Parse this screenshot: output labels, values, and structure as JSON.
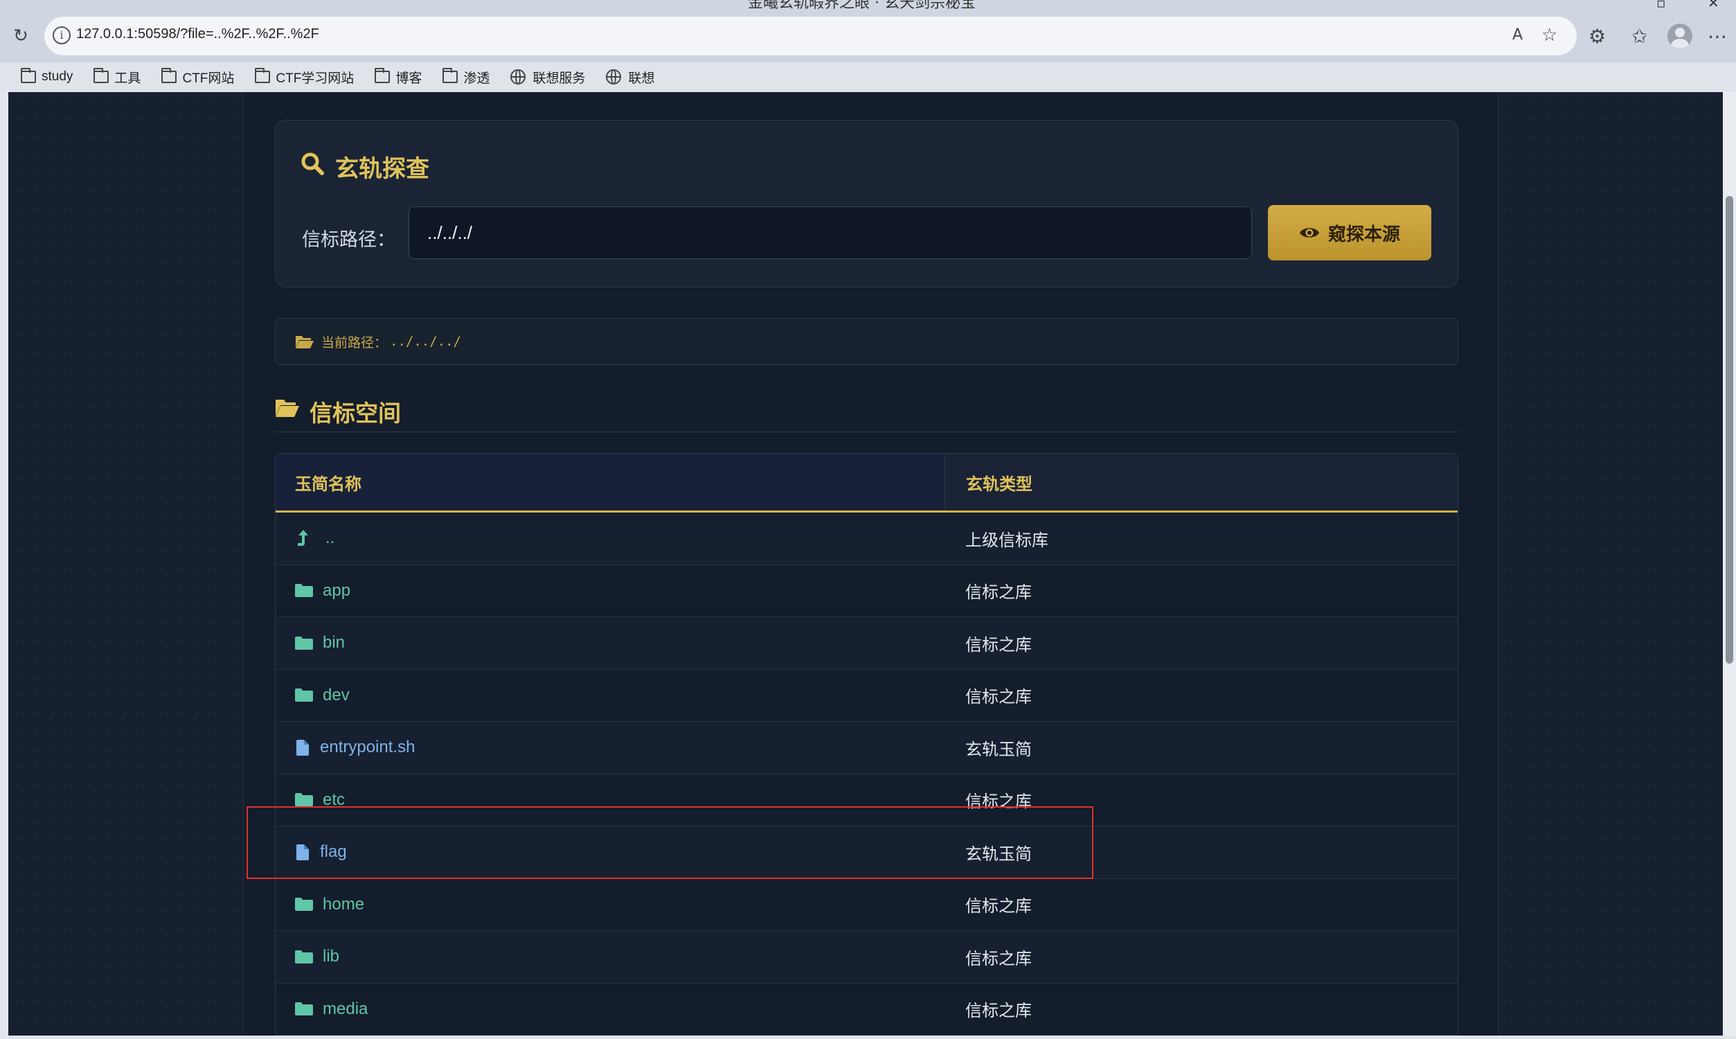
{
  "browser": {
    "window_title": "金曦玄轨暇界之眼 · 玄天剑宗秘宝",
    "url": "127.0.0.1:50598/?file=..%2F..%2F..%2F",
    "bookmarks": [
      {
        "label": "study",
        "icon": "folder-icon"
      },
      {
        "label": "工具",
        "icon": "folder-icon"
      },
      {
        "label": "CTF网站",
        "icon": "folder-icon"
      },
      {
        "label": "CTF学习网站",
        "icon": "folder-icon"
      },
      {
        "label": "博客",
        "icon": "folder-icon"
      },
      {
        "label": "渗透",
        "icon": "folder-icon"
      },
      {
        "label": "联想服务",
        "icon": "globe-icon"
      },
      {
        "label": "联想",
        "icon": "globe-icon"
      }
    ]
  },
  "search_card": {
    "title": "玄轨探查",
    "path_label": "信标路径：",
    "path_value": "../../../",
    "probe_button": "窥探本源"
  },
  "current_path": {
    "label": "当前路径：",
    "value": "../../../"
  },
  "section": {
    "title": "信标空间"
  },
  "table": {
    "headers": {
      "name": "玉简名称",
      "type": "玄轨类型"
    },
    "rows": [
      {
        "name": "..",
        "type": "上级信标库",
        "kind": "up"
      },
      {
        "name": "app",
        "type": "信标之库",
        "kind": "dir"
      },
      {
        "name": "bin",
        "type": "信标之库",
        "kind": "dir"
      },
      {
        "name": "dev",
        "type": "信标之库",
        "kind": "dir"
      },
      {
        "name": "entrypoint.sh",
        "type": "玄轨玉简",
        "kind": "file"
      },
      {
        "name": "etc",
        "type": "信标之库",
        "kind": "dir"
      },
      {
        "name": "flag",
        "type": "玄轨玉简",
        "kind": "file"
      },
      {
        "name": "home",
        "type": "信标之库",
        "kind": "dir"
      },
      {
        "name": "lib",
        "type": "信标之库",
        "kind": "dir"
      },
      {
        "name": "media",
        "type": "信标之库",
        "kind": "dir"
      }
    ]
  },
  "colors": {
    "accent_gold": "#e1c35a",
    "dir_green": "#5fc6a8",
    "file_blue": "#7fb3ea",
    "annotation_red": "#e0302a"
  }
}
